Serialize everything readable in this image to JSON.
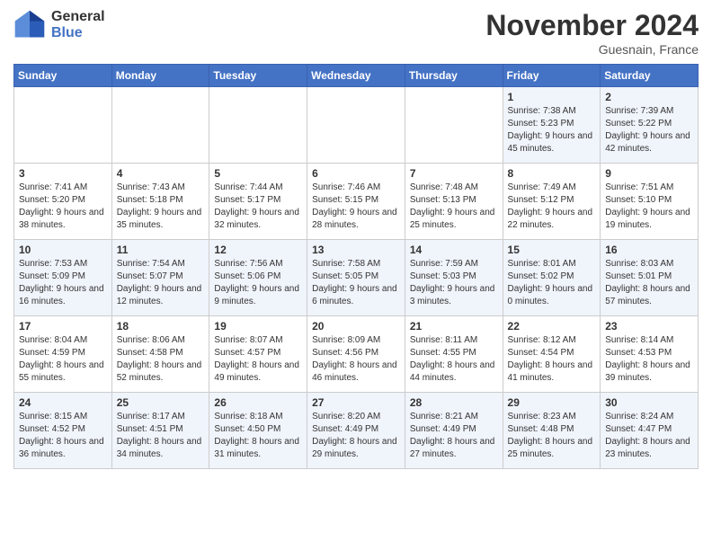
{
  "header": {
    "logo_general": "General",
    "logo_blue": "Blue",
    "month_title": "November 2024",
    "location": "Guesnain, France"
  },
  "days_of_week": [
    "Sunday",
    "Monday",
    "Tuesday",
    "Wednesday",
    "Thursday",
    "Friday",
    "Saturday"
  ],
  "weeks": [
    [
      {
        "day": "",
        "info": ""
      },
      {
        "day": "",
        "info": ""
      },
      {
        "day": "",
        "info": ""
      },
      {
        "day": "",
        "info": ""
      },
      {
        "day": "",
        "info": ""
      },
      {
        "day": "1",
        "info": "Sunrise: 7:38 AM\nSunset: 5:23 PM\nDaylight: 9 hours and 45 minutes."
      },
      {
        "day": "2",
        "info": "Sunrise: 7:39 AM\nSunset: 5:22 PM\nDaylight: 9 hours and 42 minutes."
      }
    ],
    [
      {
        "day": "3",
        "info": "Sunrise: 7:41 AM\nSunset: 5:20 PM\nDaylight: 9 hours and 38 minutes."
      },
      {
        "day": "4",
        "info": "Sunrise: 7:43 AM\nSunset: 5:18 PM\nDaylight: 9 hours and 35 minutes."
      },
      {
        "day": "5",
        "info": "Sunrise: 7:44 AM\nSunset: 5:17 PM\nDaylight: 9 hours and 32 minutes."
      },
      {
        "day": "6",
        "info": "Sunrise: 7:46 AM\nSunset: 5:15 PM\nDaylight: 9 hours and 28 minutes."
      },
      {
        "day": "7",
        "info": "Sunrise: 7:48 AM\nSunset: 5:13 PM\nDaylight: 9 hours and 25 minutes."
      },
      {
        "day": "8",
        "info": "Sunrise: 7:49 AM\nSunset: 5:12 PM\nDaylight: 9 hours and 22 minutes."
      },
      {
        "day": "9",
        "info": "Sunrise: 7:51 AM\nSunset: 5:10 PM\nDaylight: 9 hours and 19 minutes."
      }
    ],
    [
      {
        "day": "10",
        "info": "Sunrise: 7:53 AM\nSunset: 5:09 PM\nDaylight: 9 hours and 16 minutes."
      },
      {
        "day": "11",
        "info": "Sunrise: 7:54 AM\nSunset: 5:07 PM\nDaylight: 9 hours and 12 minutes."
      },
      {
        "day": "12",
        "info": "Sunrise: 7:56 AM\nSunset: 5:06 PM\nDaylight: 9 hours and 9 minutes."
      },
      {
        "day": "13",
        "info": "Sunrise: 7:58 AM\nSunset: 5:05 PM\nDaylight: 9 hours and 6 minutes."
      },
      {
        "day": "14",
        "info": "Sunrise: 7:59 AM\nSunset: 5:03 PM\nDaylight: 9 hours and 3 minutes."
      },
      {
        "day": "15",
        "info": "Sunrise: 8:01 AM\nSunset: 5:02 PM\nDaylight: 9 hours and 0 minutes."
      },
      {
        "day": "16",
        "info": "Sunrise: 8:03 AM\nSunset: 5:01 PM\nDaylight: 8 hours and 57 minutes."
      }
    ],
    [
      {
        "day": "17",
        "info": "Sunrise: 8:04 AM\nSunset: 4:59 PM\nDaylight: 8 hours and 55 minutes."
      },
      {
        "day": "18",
        "info": "Sunrise: 8:06 AM\nSunset: 4:58 PM\nDaylight: 8 hours and 52 minutes."
      },
      {
        "day": "19",
        "info": "Sunrise: 8:07 AM\nSunset: 4:57 PM\nDaylight: 8 hours and 49 minutes."
      },
      {
        "day": "20",
        "info": "Sunrise: 8:09 AM\nSunset: 4:56 PM\nDaylight: 8 hours and 46 minutes."
      },
      {
        "day": "21",
        "info": "Sunrise: 8:11 AM\nSunset: 4:55 PM\nDaylight: 8 hours and 44 minutes."
      },
      {
        "day": "22",
        "info": "Sunrise: 8:12 AM\nSunset: 4:54 PM\nDaylight: 8 hours and 41 minutes."
      },
      {
        "day": "23",
        "info": "Sunrise: 8:14 AM\nSunset: 4:53 PM\nDaylight: 8 hours and 39 minutes."
      }
    ],
    [
      {
        "day": "24",
        "info": "Sunrise: 8:15 AM\nSunset: 4:52 PM\nDaylight: 8 hours and 36 minutes."
      },
      {
        "day": "25",
        "info": "Sunrise: 8:17 AM\nSunset: 4:51 PM\nDaylight: 8 hours and 34 minutes."
      },
      {
        "day": "26",
        "info": "Sunrise: 8:18 AM\nSunset: 4:50 PM\nDaylight: 8 hours and 31 minutes."
      },
      {
        "day": "27",
        "info": "Sunrise: 8:20 AM\nSunset: 4:49 PM\nDaylight: 8 hours and 29 minutes."
      },
      {
        "day": "28",
        "info": "Sunrise: 8:21 AM\nSunset: 4:49 PM\nDaylight: 8 hours and 27 minutes."
      },
      {
        "day": "29",
        "info": "Sunrise: 8:23 AM\nSunset: 4:48 PM\nDaylight: 8 hours and 25 minutes."
      },
      {
        "day": "30",
        "info": "Sunrise: 8:24 AM\nSunset: 4:47 PM\nDaylight: 8 hours and 23 minutes."
      }
    ]
  ]
}
